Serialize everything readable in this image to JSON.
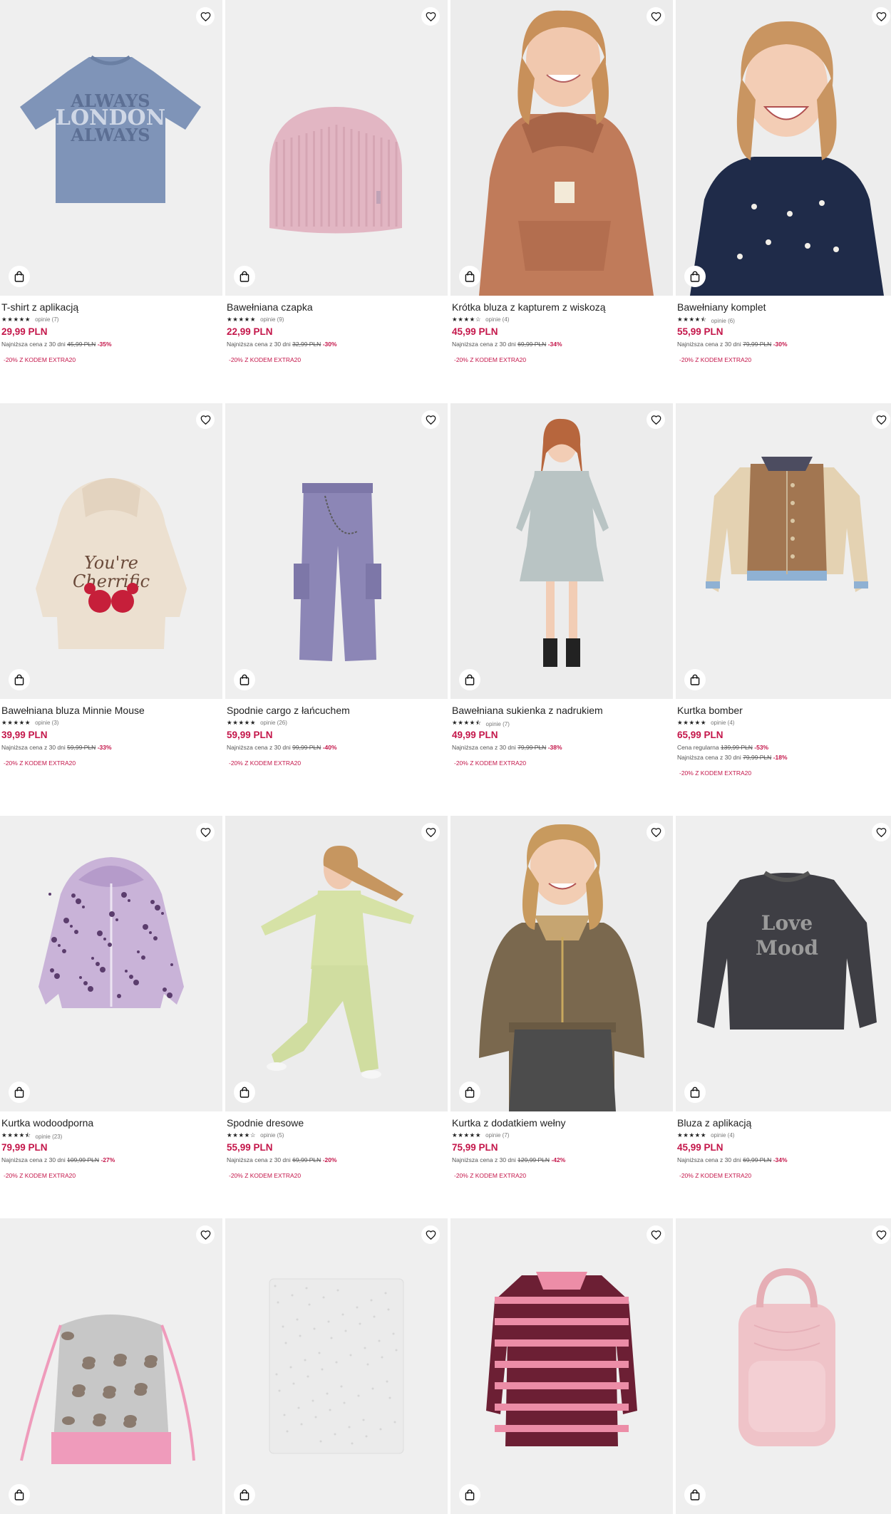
{
  "colors": {
    "accent": "#c4164a",
    "image_bg": "#efefef"
  },
  "icons": {
    "wishlist": "heart-outline-icon",
    "cart": "shopping-bag-icon"
  },
  "products": [
    {
      "name": "T-shirt z aplikacją",
      "stars": "★★★★★",
      "reviews": "opinie (7)",
      "price": "29,99 PLN",
      "lines": [
        {
          "label": "Najniższa cena z 30 dni",
          "old": "45,99 PLN",
          "disc": "-35%"
        }
      ],
      "code": "-20% Z KODEM EXTRA20",
      "art": "tshirt"
    },
    {
      "name": "Bawełniana czapka",
      "stars": "★★★★★",
      "reviews": "opinie (9)",
      "price": "22,99 PLN",
      "lines": [
        {
          "label": "Najniższa cena z 30 dni",
          "old": "32,99 PLN",
          "disc": "-30%"
        }
      ],
      "code": "-20% Z KODEM EXTRA20",
      "art": "beanie"
    },
    {
      "name": "Krótka bluza z kapturem z wiskozą",
      "stars": "★★★★☆",
      "reviews": "opinie (4)",
      "price": "45,99 PLN",
      "lines": [
        {
          "label": "Najniższa cena z 30 dni",
          "old": "69,99 PLN",
          "disc": "-34%"
        }
      ],
      "code": "-20% Z KODEM EXTRA20",
      "art": "girl-hoodie"
    },
    {
      "name": "Bawełniany komplet",
      "stars": "★★★★⯪",
      "reviews": "opinie (6)",
      "price": "55,99 PLN",
      "lines": [
        {
          "label": "Najniższa cena z 30 dni",
          "old": "79,99 PLN",
          "disc": "-30%"
        }
      ],
      "code": "-20% Z KODEM EXTRA20",
      "art": "girl-navy"
    },
    {
      "name": "Bawełniana bluza Minnie Mouse",
      "stars": "★★★★★",
      "reviews": "opinie (3)",
      "price": "39,99 PLN",
      "lines": [
        {
          "label": "Najniższa cena z 30 dni",
          "old": "59,99 PLN",
          "disc": "-33%"
        }
      ],
      "code": "-20% Z KODEM EXTRA20",
      "art": "minnie"
    },
    {
      "name": "Spodnie cargo z łańcuchem",
      "stars": "★★★★★",
      "reviews": "opinie (26)",
      "price": "59,99 PLN",
      "lines": [
        {
          "label": "Najniższa cena z 30 dni",
          "old": "99,99 PLN",
          "disc": "-40%"
        }
      ],
      "code": "-20% Z KODEM EXTRA20",
      "art": "cargo"
    },
    {
      "name": "Bawełniana sukienka z nadrukiem",
      "stars": "★★★★⯪",
      "reviews": "opinie (7)",
      "price": "49,99 PLN",
      "lines": [
        {
          "label": "Najniższa cena z 30 dni",
          "old": "79,99 PLN",
          "disc": "-38%"
        }
      ],
      "code": "-20% Z KODEM EXTRA20",
      "art": "girl-dress"
    },
    {
      "name": "Kurtka bomber",
      "stars": "★★★★★",
      "reviews": "opinie (4)",
      "price": "65,99 PLN",
      "lines": [
        {
          "label": "Cena regularna",
          "old": "139,99 PLN",
          "disc": "-53%"
        },
        {
          "label": "Najniższa cena z 30 dni",
          "old": "79,99 PLN",
          "disc": "-18%"
        }
      ],
      "code": "-20% Z KODEM EXTRA20",
      "art": "bomber"
    },
    {
      "name": "Kurtka wodoodporna",
      "stars": "★★★★⯪",
      "reviews": "opinie (23)",
      "price": "79,99 PLN",
      "lines": [
        {
          "label": "Najniższa cena z 30 dni",
          "old": "109,99 PLN",
          "disc": "-27%"
        }
      ],
      "code": "-20% Z KODEM EXTRA20",
      "art": "rain-jacket"
    },
    {
      "name": "Spodnie dresowe",
      "stars": "★★★★☆",
      "reviews": "opinie (5)",
      "price": "55,99 PLN",
      "lines": [
        {
          "label": "Najniższa cena z 30 dni",
          "old": "69,99 PLN",
          "disc": "-20%"
        }
      ],
      "code": "-20% Z KODEM EXTRA20",
      "art": "girl-green"
    },
    {
      "name": "Kurtka z dodatkiem wełny",
      "stars": "★★★★★",
      "reviews": "opinie (7)",
      "price": "75,99 PLN",
      "lines": [
        {
          "label": "Najniższa cena z 30 dni",
          "old": "129,99 PLN",
          "disc": "-42%"
        }
      ],
      "code": "-20% Z KODEM EXTRA20",
      "art": "girl-jacket"
    },
    {
      "name": "Bluza z aplikacją",
      "stars": "★★★★★",
      "reviews": "opinie (4)",
      "price": "45,99 PLN",
      "lines": [
        {
          "label": "Najniższa cena z 30 dni",
          "old": "69,99 PLN",
          "disc": "-34%"
        }
      ],
      "code": "-20% Z KODEM EXTRA20",
      "art": "sweatshirt"
    },
    {
      "name": "",
      "stars": "",
      "reviews": "",
      "price": "",
      "lines": [],
      "code": "",
      "art": "drawstring-bag"
    },
    {
      "name": "",
      "stars": "",
      "reviews": "",
      "price": "",
      "lines": [],
      "code": "",
      "art": "scarf"
    },
    {
      "name": "",
      "stars": "",
      "reviews": "",
      "price": "",
      "lines": [],
      "code": "",
      "art": "polo-dress"
    },
    {
      "name": "",
      "stars": "",
      "reviews": "",
      "price": "",
      "lines": [],
      "code": "",
      "art": "backpack"
    }
  ]
}
